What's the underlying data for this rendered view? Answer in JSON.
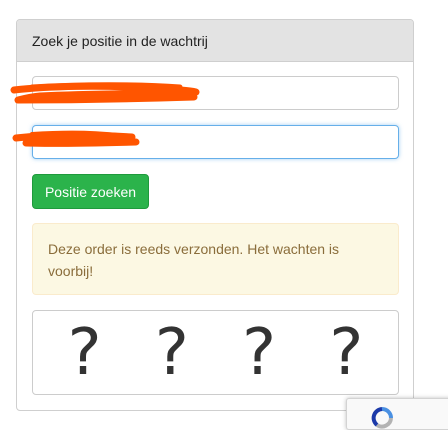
{
  "panel": {
    "title": "Zoek je positie in de wachtrij"
  },
  "form": {
    "field1_value": "",
    "field2_value": "",
    "submit_label": "Positie zoeken"
  },
  "alert": {
    "message": "Deze order is reeds verzonden. Het wachten is voorbij!"
  },
  "captcha": {
    "symbols": [
      "?",
      "?",
      "?",
      "?"
    ]
  },
  "colors": {
    "button": "#2bb34b",
    "alert_bg": "#fcf8e3",
    "alert_text": "#8a6d3b",
    "focus_border": "#66afe9",
    "redaction": "#ff5500"
  },
  "icons": {
    "recaptcha_badge": "recaptcha-icon"
  }
}
